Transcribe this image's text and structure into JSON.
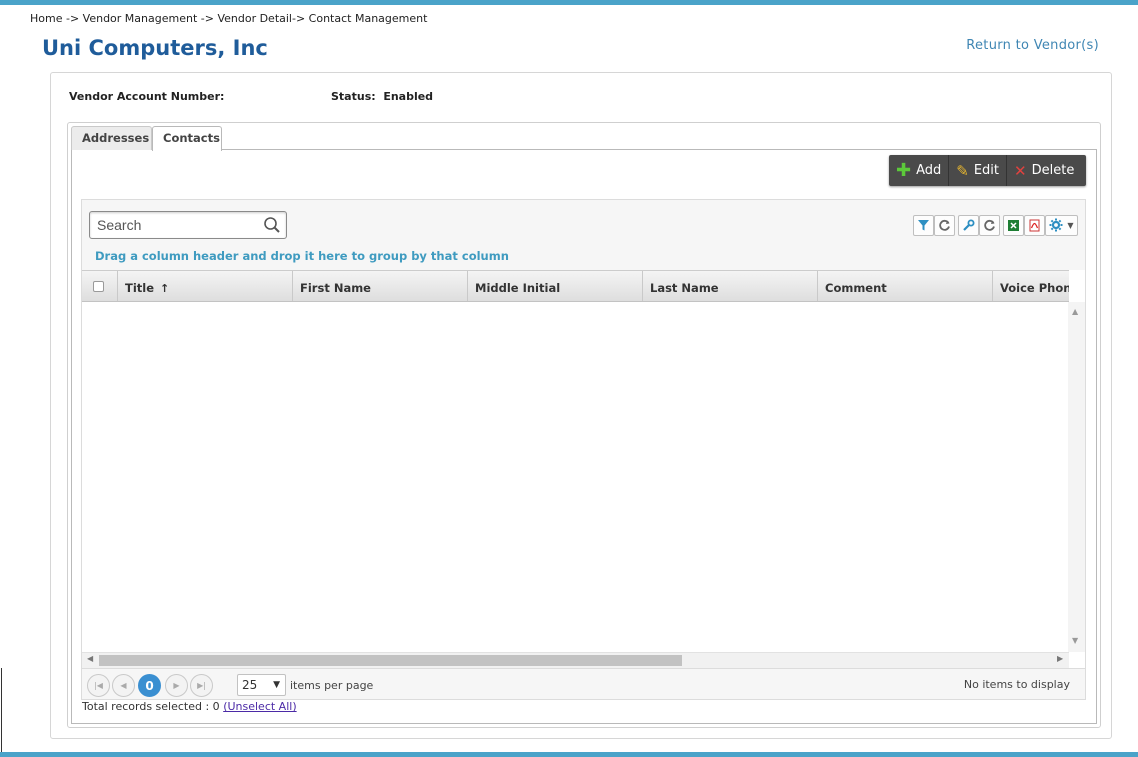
{
  "breadcrumb": "Home -> Vendor Management -> Vendor Detail-> Contact Management",
  "vendor_name": "Uni Computers, Inc",
  "return_link": "Return to Vendor(s)",
  "info": {
    "account_label": "Vendor Account Number:",
    "status_label": "Status:",
    "status_value": "Enabled"
  },
  "tabs": [
    {
      "label": "Addresses",
      "active": false
    },
    {
      "label": "Contacts",
      "active": true
    }
  ],
  "toolbar": {
    "add": "Add",
    "edit": "Edit",
    "delete": "Delete"
  },
  "grid": {
    "search_placeholder": "Search",
    "group_hint": "Drag a column header and drop it here to group by that column",
    "columns": [
      "Title",
      "First Name",
      "Middle Initial",
      "Last Name",
      "Comment",
      "Voice Phone"
    ],
    "sort_indicator": "↑"
  },
  "pager": {
    "current_page": "0",
    "page_size": "25",
    "items_per_page": "items per page",
    "no_items": "No items to display"
  },
  "selection": {
    "label": "Total records selected : 0",
    "unselect": "(Unselect All)"
  },
  "colors": {
    "accent_bar": "#4aa3c9",
    "title": "#1f5c9a",
    "hint": "#3f9bc0",
    "pager_current": "#3a8fd1"
  }
}
